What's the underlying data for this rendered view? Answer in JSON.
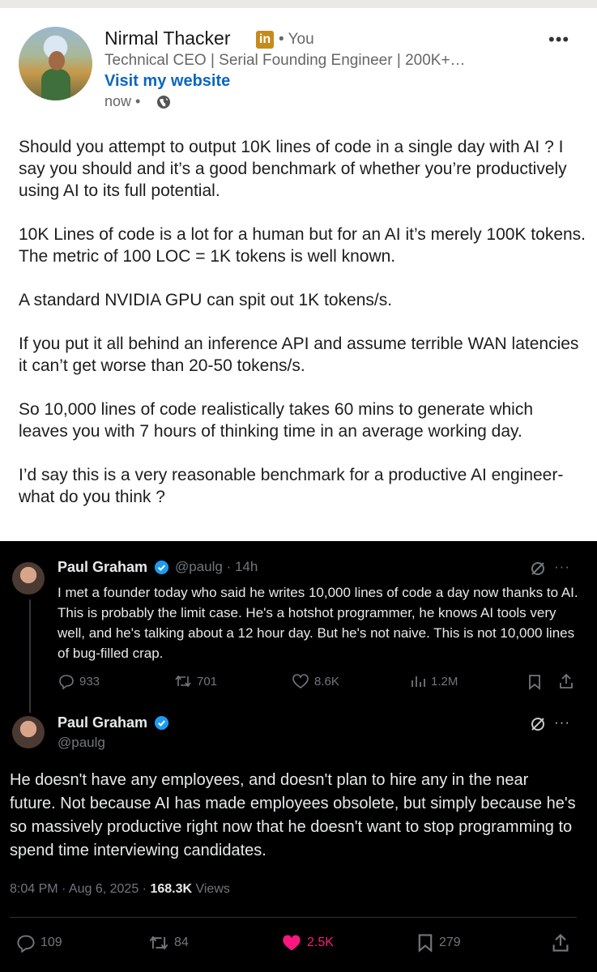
{
  "linkedin": {
    "author_name": "Nirmal Thacker",
    "badge": "in",
    "you_label": "• You",
    "headline": "Technical CEO | Serial Founding Engineer | 200K+…",
    "website_link": "Visit my website",
    "posted": "now •",
    "more": "•••",
    "paragraphs": [
      "Should you attempt to output 10K lines of code in a single day with AI ? I say you should and it’s a good benchmark of whether you’re productively using AI to its full potential.",
      "10K Lines of code is a lot for a human but for an AI it’s merely 100K tokens. The metric of 100 LOC = 1K tokens is well known.",
      "A standard NVIDIA GPU can spit out 1K tokens/s.",
      "If you put it all behind an inference API and assume terrible WAN latencies it can’t get worse than 20-50 tokens/s.",
      "So 10,000 lines of code realistically takes 60 mins to generate which leaves you with 7 hours of thinking time in an average working day.",
      "I’d say this is a very reasonable benchmark for a productive AI engineer- what do you think ?"
    ]
  },
  "tweet1": {
    "name": "Paul Graham",
    "handle_time": "@paulg · 14h",
    "more": "···",
    "text": "I met a founder today who said he writes 10,000 lines of code a day now thanks to AI. This is probably the limit case. He's a hotshot programmer, he knows AI tools very well, and he's talking about a 12 hour day. But he's not naive. This is not 10,000 lines of bug-filled crap.",
    "replies": "933",
    "reposts": "701",
    "likes": "8.6K",
    "views": "1.2M"
  },
  "tweet2": {
    "name": "Paul Graham",
    "handle": "@paulg",
    "more": "···",
    "text": "He doesn't have any employees, and doesn't plan to hire any in the near future. Not because AI has made employees obsolete, but simply because he's so massively productive right now that he doesn't want to stop programming to spend time interviewing candidates.",
    "timestamp": "8:04 PM · Aug 6, 2025 · ",
    "views_count": "168.3K",
    "views_label": " Views",
    "replies": "109",
    "reposts": "84",
    "likes": "2.5K",
    "bookmarks": "279"
  },
  "colors": {
    "linkedin_blue": "#0a66c2",
    "x_blue": "#1d9bf0",
    "like_pink": "#f91880",
    "x_background": "#000000"
  }
}
